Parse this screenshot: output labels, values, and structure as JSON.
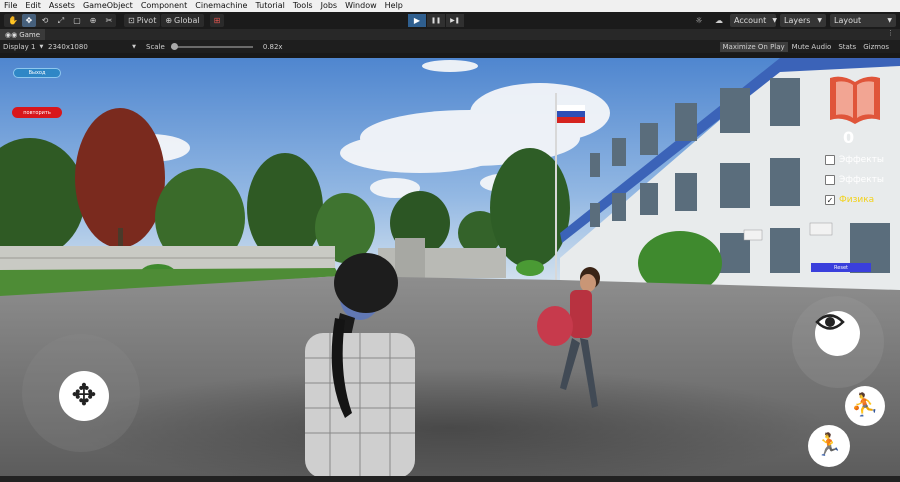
{
  "menu": [
    "File",
    "Edit",
    "Assets",
    "GameObject",
    "Component",
    "Cinemachine",
    "Tutorial",
    "Tools",
    "Jobs",
    "Window",
    "Help"
  ],
  "toolbar": {
    "tools": [
      {
        "icon": "hand-icon",
        "glyph": "✋"
      },
      {
        "icon": "move-icon",
        "glyph": "✥"
      },
      {
        "icon": "rotate-icon",
        "glyph": "⟲"
      },
      {
        "icon": "scale-icon",
        "glyph": "⤢"
      },
      {
        "icon": "rect-icon",
        "glyph": "▢"
      },
      {
        "icon": "transform-icon",
        "glyph": "⊕"
      },
      {
        "icon": "custom-tool-icon",
        "glyph": "✂"
      }
    ],
    "pivot_label": "Pivot",
    "global_label": "Global",
    "play": {
      "play_glyph": "▶",
      "pause_glyph": "❚❚",
      "step_glyph": "▶❚"
    },
    "account_label": "Account",
    "layers_label": "Layers",
    "layout_label": "Layout"
  },
  "game_tab": {
    "label": "Game",
    "menu_glyph": "⋮"
  },
  "game_controls": {
    "display": "Display 1",
    "resolution": "2340x1080",
    "scale_label": "Scale",
    "scale_value": "0.82x",
    "maximize": "Maximize On Play",
    "mute": "Mute Audio",
    "stats": "Stats",
    "gizmos": "Gizmos"
  },
  "hud": {
    "exit_label": "Выход",
    "repeat_label": "повторить",
    "score": "0",
    "checkboxes": [
      {
        "label": "Эффекты",
        "checked": false,
        "color": "#ffffff"
      },
      {
        "label": "Эффекты",
        "checked": false,
        "color": "#ffffff"
      },
      {
        "label": "Физика",
        "checked": true,
        "color": "#f2d21b"
      }
    ],
    "reset_label": "Reset",
    "colors": {
      "exit": "#2f87c6",
      "repeat": "#d8161b",
      "book": "#e0553a"
    }
  }
}
